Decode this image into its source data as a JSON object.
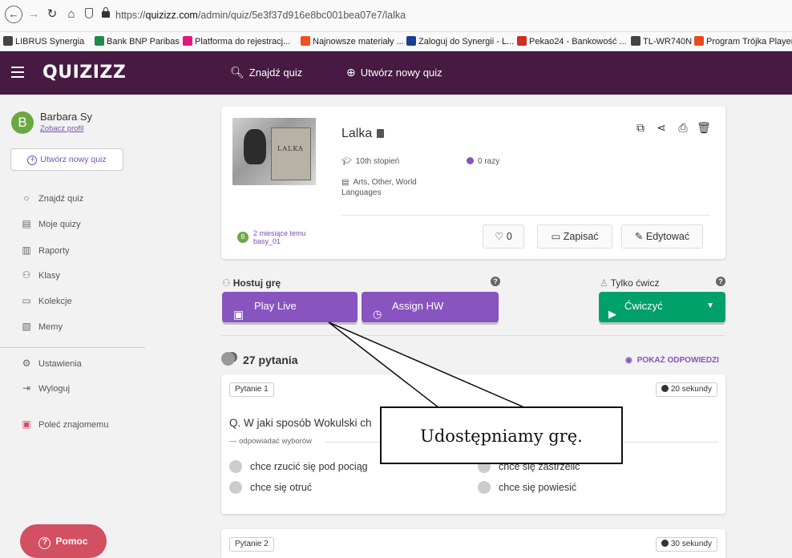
{
  "browser": {
    "url_prefix": "https://",
    "url_domain": "quizizz.com",
    "url_path": "/admin/quiz/5e3f37d916e8bc001bea07e7/lalka",
    "bookmarks": [
      {
        "label": "LIBRUS Synergia",
        "color": "#444444"
      },
      {
        "label": "Bank BNP Paribas",
        "color": "#1e8a4c"
      },
      {
        "label": "Platforma do rejestracj...",
        "color": "#e2197a"
      },
      {
        "label": "Najnowsze materiały ...",
        "color": "#f25022"
      },
      {
        "label": "Zaloguj do Synergii - L...",
        "color": "#1a3f8f"
      },
      {
        "label": "Pekao24 - Bankowość ...",
        "color": "#d52b1e"
      },
      {
        "label": "TL-WR740N",
        "color": "#444444"
      },
      {
        "label": "Program Trójka Player",
        "color": "#e84a1c"
      }
    ]
  },
  "appbar": {
    "logo": "QUIZIZZ",
    "find_quiz": "Znajdź quiz",
    "create_quiz": "Utwórz nowy quiz"
  },
  "sidebar": {
    "avatar_letter": "B",
    "user_name": "Barbara Sy",
    "view_profile": "Zobacz profil",
    "create_quiz": "Utwórz nowy quiz",
    "items": [
      {
        "label": "Znajdź quiz",
        "icon": "search-icon"
      },
      {
        "label": "Moje quizy",
        "icon": "document-icon"
      },
      {
        "label": "Raporty",
        "icon": "chart-icon"
      },
      {
        "label": "Klasy",
        "icon": "users-icon"
      },
      {
        "label": "Kolekcje",
        "icon": "folder-icon"
      },
      {
        "label": "Memy",
        "icon": "image-icon"
      },
      {
        "label": "Ustawienia",
        "icon": "gear-icon"
      },
      {
        "label": "Wyloguj",
        "icon": "logout-icon"
      },
      {
        "label": "Poleć znajomemu",
        "icon": "gift-icon"
      }
    ],
    "help": "Pomoc"
  },
  "quiz": {
    "title": "Lalka",
    "book_text": "LALKA",
    "grade": "10th stopień",
    "plays": "0 razy",
    "subjects": "Arts, Other, World Languages",
    "author_avatar": "B",
    "created": "2 miesiące temu",
    "author": "basy_01",
    "likes": "0",
    "save": "Zapisać",
    "edit": "Edytować"
  },
  "host": {
    "label": "Hostuj grę",
    "play_live": "Play Live",
    "assign_hw": "Assign HW",
    "practice_label": "Tylko ćwicz",
    "practice_btn": "Ćwiczyć"
  },
  "questions": {
    "count": "27 pytania",
    "show_answers": "POKAŻ ODPOWIEDZI",
    "items": [
      {
        "tag": "Pytanie 1",
        "time": "20 sekundy",
        "text": "Q. W jaki sposób Wokulski ch",
        "answers_label": "odpowiadać wyborów",
        "choices": [
          "chce rzucić się pod pociąg",
          "chce się zastrzelić",
          "chce się otruć",
          "chce się powiesić"
        ]
      },
      {
        "tag": "Pytanie 2",
        "time": "30 sekundy"
      }
    ]
  },
  "annotation": {
    "text": "Udostępniamy grę."
  }
}
